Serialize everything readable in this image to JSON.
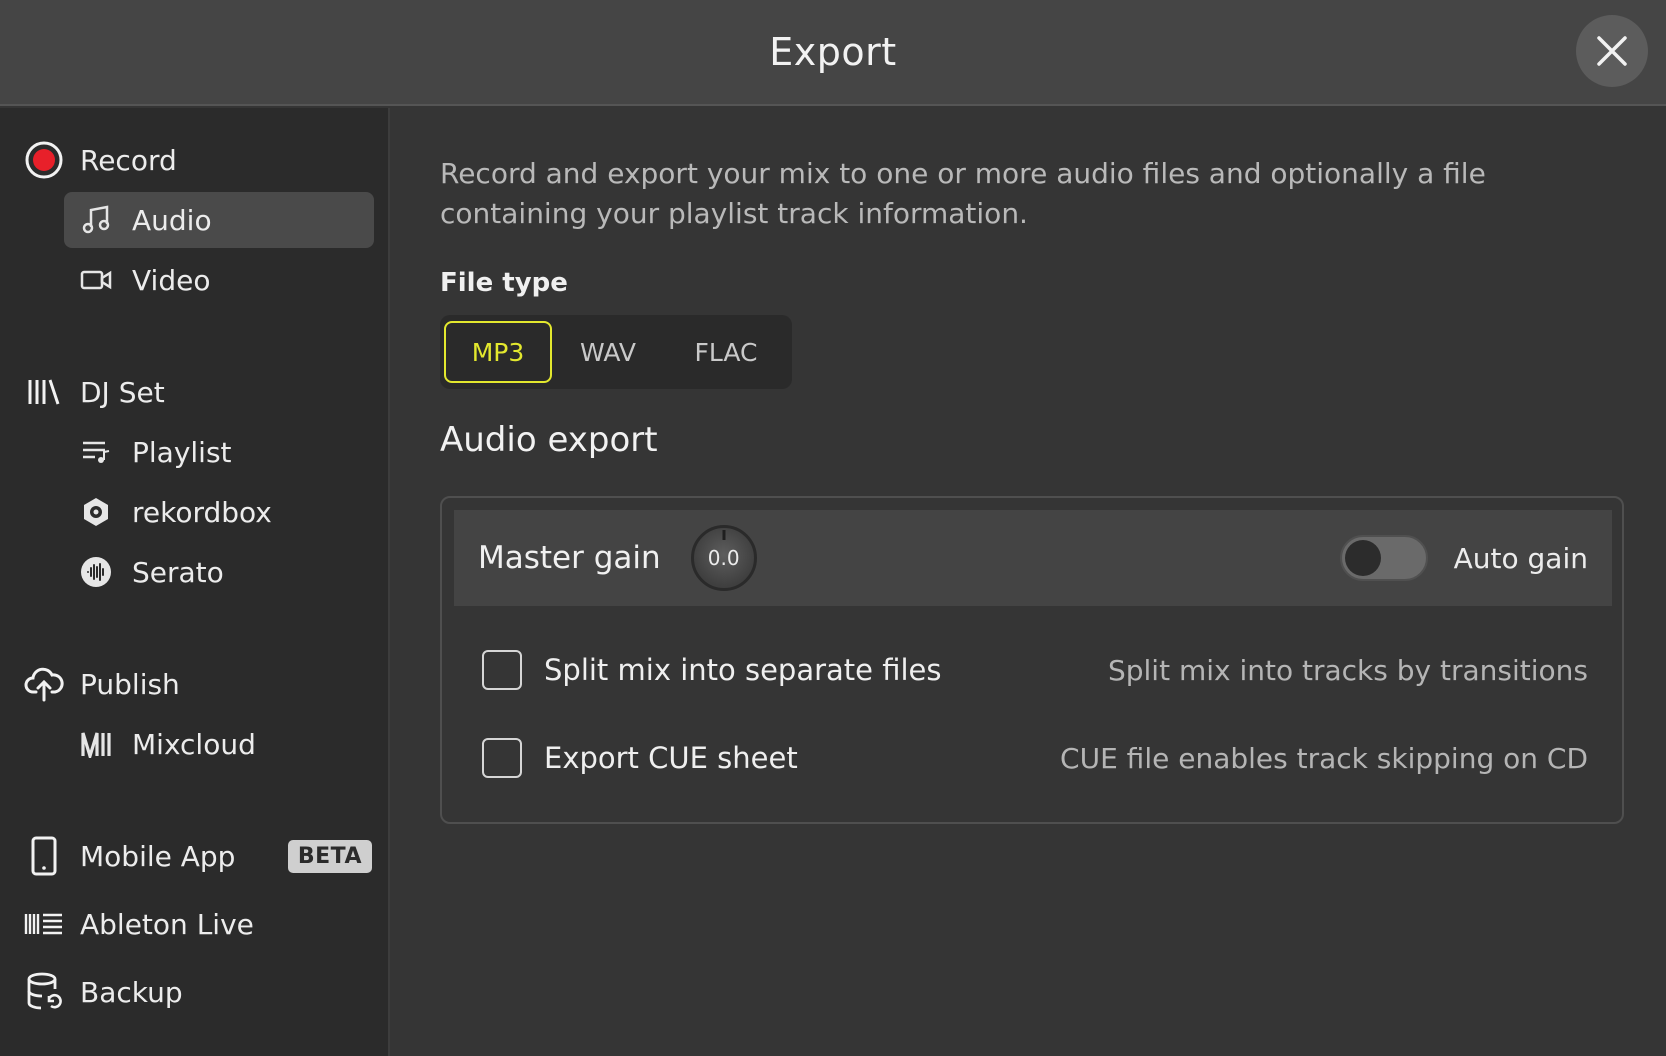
{
  "window": {
    "title": "Export"
  },
  "sidebar": {
    "record": {
      "label": "Record",
      "items": [
        {
          "label": "Audio",
          "icon": "music-note-icon"
        },
        {
          "label": "Video",
          "icon": "video-camera-icon"
        }
      ]
    },
    "djset": {
      "label": "DJ Set",
      "items": [
        {
          "label": "Playlist",
          "icon": "playlist-icon"
        },
        {
          "label": "rekordbox",
          "icon": "rekordbox-icon"
        },
        {
          "label": "Serato",
          "icon": "serato-icon"
        }
      ]
    },
    "publish": {
      "label": "Publish",
      "items": [
        {
          "label": "Mixcloud",
          "icon": "mixcloud-icon"
        }
      ]
    },
    "mobile": {
      "label": "Mobile App",
      "badge": "BETA"
    },
    "ableton": {
      "label": "Ableton Live"
    },
    "backup": {
      "label": "Backup"
    }
  },
  "main": {
    "description": "Record and export your mix to one or more audio files and optionally a file containing your playlist track information.",
    "file_type_label": "File type",
    "file_types": [
      "MP3",
      "WAV",
      "FLAC"
    ],
    "selected_file_type": "MP3",
    "section_title": "Audio export",
    "master_gain_label": "Master gain",
    "master_gain_value": "0.0",
    "auto_gain_label": "Auto gain",
    "auto_gain_on": false,
    "options": [
      {
        "label": "Split mix into separate files",
        "hint": "Split mix into tracks by transitions",
        "checked": false
      },
      {
        "label": "Export CUE sheet",
        "hint": "CUE file enables track skipping on CD",
        "checked": false
      }
    ]
  },
  "colors": {
    "accent": "#e3e82e",
    "record_red": "#e8202a",
    "background": "#353535",
    "sidebar": "#2b2b2b"
  }
}
